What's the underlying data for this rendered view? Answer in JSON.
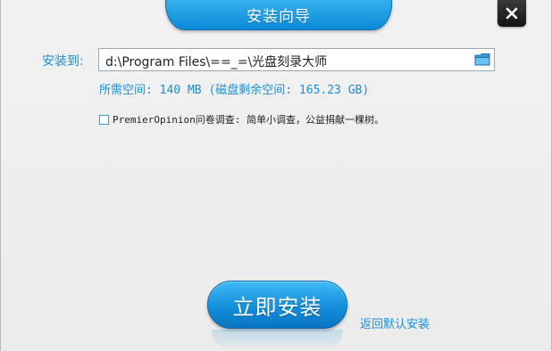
{
  "window": {
    "title": "安装向导",
    "close_icon": "close-icon"
  },
  "install_path": {
    "label": "安装到:",
    "value": "d:\\Program Files\\==_=\\光盘刻录大师",
    "browse_icon": "folder-icon"
  },
  "space_info": "所需空间: 140 MB (磁盘剩余空间: 165.23 GB)",
  "survey": {
    "checked": false,
    "text": "PremierOpinion问卷调查: 简单小调查，公益捐献一棵树。"
  },
  "actions": {
    "install_label": "立即安装",
    "restore_default_label": "返回默认安装"
  },
  "colors": {
    "accent": "#1a8fd3",
    "button_top": "#40b9f5",
    "button_bottom": "#0a74c2",
    "close_bg": "#1e1e1e"
  }
}
